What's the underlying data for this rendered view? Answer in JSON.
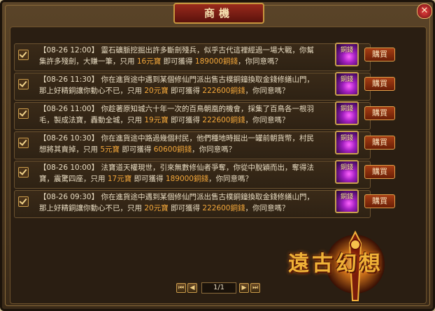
{
  "window": {
    "title": "商機",
    "close_label": "✕"
  },
  "colors": {
    "accent_gold": "#f3a73a",
    "text": "#e8dcc2",
    "frame": "#3a2a18"
  },
  "rows": [
    {
      "time": "【08-26 12:00】",
      "text_a": "靈石礦脈挖掘出許多斷劍殘兵，似乎古代這裡經過一場大戰，你幫集許多殘劍，大賺一筆，只用",
      "price": "16元寶",
      "text_b": "即可獲得",
      "reward": "189000銅錢",
      "text_c": "，你同意嗎？",
      "item_label": "銅錢",
      "buy_label": "購買"
    },
    {
      "time": "【08-26 11:30】",
      "text_a": "你在進貨途中遇到某個修仙門派出售古樸銅鐘換取金錢修繕山門，那上好精銅讓你動心不已，只用",
      "price": "20元寶",
      "text_b": "即可獲得",
      "reward": "222600銅錢",
      "text_c": "，你同意嗎？",
      "item_label": "銅錢",
      "buy_label": "購買"
    },
    {
      "time": "【08-26 11:00】",
      "text_a": "你趁著原知城六十年一次的百鳥朝凰的機會，採集了百鳥各一根羽毛，製成法寶，轟動全城，只用",
      "price": "19元寶",
      "text_b": "即可獲得",
      "reward": "222600銅錢",
      "text_c": "，你同意嗎？",
      "item_label": "銅錢",
      "buy_label": "購買"
    },
    {
      "time": "【08-26 10:30】",
      "text_a": "你在進貨途中路過幾個村民，他們種地時掘出一罐前朝貨幣，村民想將其賣掉，只用",
      "price": "5元寶",
      "text_b": "即可獲得",
      "reward": "60600銅錢",
      "text_c": "，你同意嗎？",
      "item_label": "銅錢",
      "buy_label": "購買"
    },
    {
      "time": "【08-26 10:00】",
      "text_a": "法寶道天權現世，引來無數修仙者爭奪，你從中脫穎而出，奪得法寶，震驚四座，只用",
      "price": "17元寶",
      "text_b": "即可獲得",
      "reward": "189000銅錢",
      "text_c": "，你同意嗎？",
      "item_label": "銅錢",
      "buy_label": "購買"
    },
    {
      "time": "【08-26 09:30】",
      "text_a": "你在進貨途中遇到某個修仙門派出售古樸銅鐘換取金錢修繕山門，那上好精銅讓你動心不已，只用",
      "price": "20元寶",
      "text_b": "即可獲得",
      "reward": "222600銅錢",
      "text_c": "，你同意嗎？",
      "item_label": "銅錢",
      "buy_label": "購買"
    }
  ],
  "pager": {
    "current": "1/1",
    "first_icon": "first-page-icon",
    "prev_icon": "prev-page-icon",
    "next_icon": "next-page-icon",
    "last_icon": "last-page-icon"
  },
  "logo": {
    "text": "遠古幻想"
  }
}
